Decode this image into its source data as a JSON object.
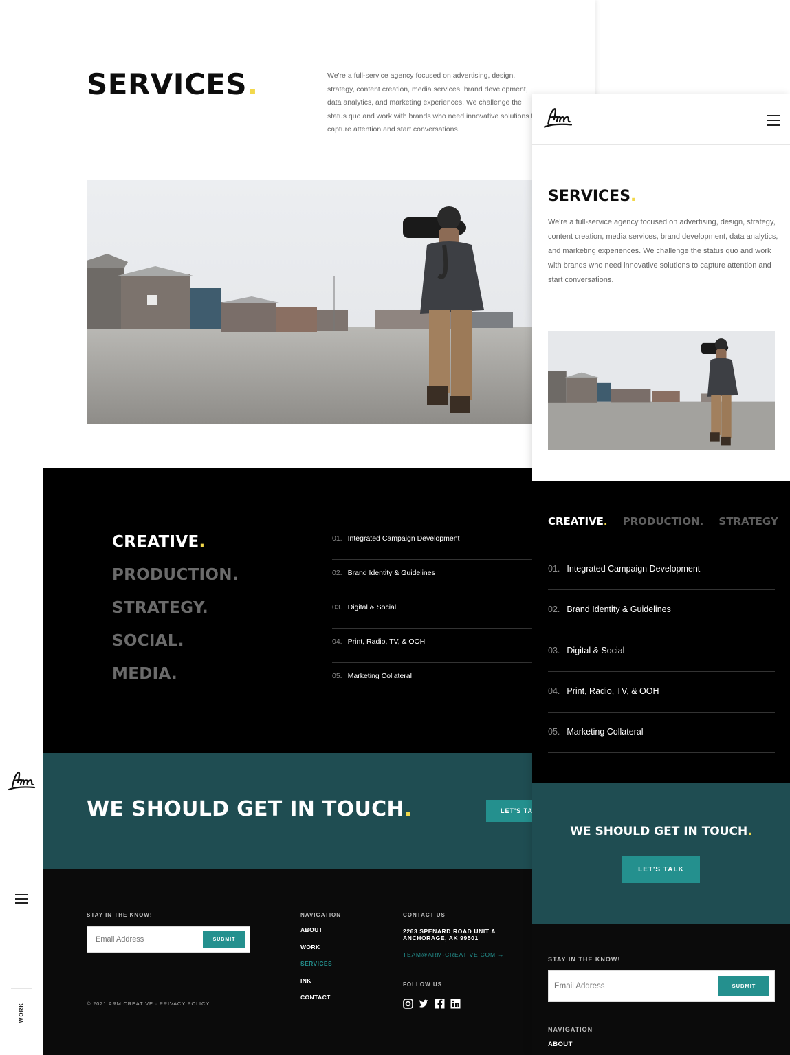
{
  "brand": {
    "logo_text": "Arm",
    "accent_color": "#f2d84b",
    "teal_color": "#1f4d52",
    "button_color": "#24908e"
  },
  "desktop": {
    "title": "SERVICES",
    "intro": "We're a full-service agency focused on advertising, design, strategy, content creation, media services, brand development, data analytics, and marketing experiences. We challenge the status quo and work with brands who need innovative solutions to capture attention and start conversations.",
    "rail": {
      "work_label": "WORK"
    },
    "categories": [
      {
        "label": "CREATIVE",
        "active": true
      },
      {
        "label": "PRODUCTION."
      },
      {
        "label": "STRATEGY."
      },
      {
        "label": "SOCIAL."
      },
      {
        "label": "MEDIA."
      }
    ],
    "services": [
      {
        "num": "01.",
        "label": "Integrated Campaign Development"
      },
      {
        "num": "02.",
        "label": "Brand Identity & Guidelines"
      },
      {
        "num": "03.",
        "label": "Digital & Social"
      },
      {
        "num": "04.",
        "label": "Print, Radio, TV, & OOH"
      },
      {
        "num": "05.",
        "label": "Marketing Collateral"
      }
    ],
    "cta": {
      "title": "WE SHOULD GET IN TOUCH",
      "button": "LET'S TALK"
    },
    "footer": {
      "newsletter_label": "STAY IN THE KNOW!",
      "email_placeholder": "Email Address",
      "submit": "SUBMIT",
      "copyright": "© 2021 ARM CREATIVE · PRIVACY POLICY",
      "nav_label": "NAVIGATION",
      "nav": [
        "ABOUT",
        "WORK",
        "SERVICES",
        "INK",
        "CONTACT"
      ],
      "contact_label": "CONTACT US",
      "address_line1": "2263 SPENARD ROAD UNIT A",
      "address_line2": "ANCHORAGE, AK 99501",
      "email": "TEAM@ARM-CREATIVE.COM",
      "follow_label": "FOLLOW US",
      "social": [
        "instagram-icon",
        "twitter-icon",
        "facebook-icon",
        "linkedin-icon"
      ]
    }
  },
  "mobile": {
    "title": "SERVICES",
    "intro": "We're a full-service agency focused on advertising, design, strategy, content creation, media services, brand development, data analytics, and marketing experiences. We challenge the status quo and work with brands who need innovative solutions to capture attention and start conversations.",
    "tabs": [
      {
        "label": "CREATIVE",
        "active": true
      },
      {
        "label": "PRODUCTION."
      },
      {
        "label": "STRATEGY"
      }
    ],
    "services": [
      {
        "num": "01.",
        "label": "Integrated Campaign Development"
      },
      {
        "num": "02.",
        "label": "Brand Identity & Guidelines"
      },
      {
        "num": "03.",
        "label": "Digital & Social"
      },
      {
        "num": "04.",
        "label": "Print, Radio, TV, & OOH"
      },
      {
        "num": "05.",
        "label": "Marketing Collateral"
      }
    ],
    "cta": {
      "title": "WE SHOULD GET IN TOUCH",
      "button": "LET'S TALK"
    },
    "footer": {
      "newsletter_label": "STAY IN THE KNOW!",
      "email_placeholder": "Email Address",
      "submit": "SUBMIT",
      "nav_label": "NAVIGATION",
      "first_nav": "ABOUT"
    }
  }
}
